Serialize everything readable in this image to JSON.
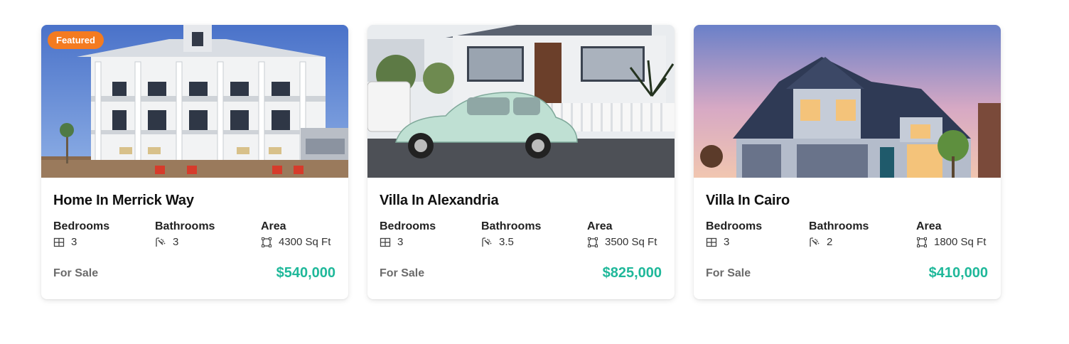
{
  "listings": [
    {
      "badge": "Featured",
      "title": "Home In Merrick Way",
      "bedrooms_label": "Bedrooms",
      "bedrooms": "3",
      "bathrooms_label": "Bathrooms",
      "bathrooms": "3",
      "area_label": "Area",
      "area": "4300 Sq Ft",
      "status": "For Sale",
      "price": "$540,000"
    },
    {
      "title": "Villa In Alexandria",
      "bedrooms_label": "Bedrooms",
      "bedrooms": "3",
      "bathrooms_label": "Bathrooms",
      "bathrooms": "3.5",
      "area_label": "Area",
      "area": "3500 Sq Ft",
      "status": "For Sale",
      "price": "$825,000"
    },
    {
      "title": "Villa In Cairo",
      "bedrooms_label": "Bedrooms",
      "bedrooms": "3",
      "bathrooms_label": "Bathrooms",
      "bathrooms": "2",
      "area_label": "Area",
      "area": "1800 Sq Ft",
      "status": "For Sale",
      "price": "$410,000"
    }
  ],
  "colors": {
    "badge": "#f47b20",
    "price": "#1fb89a"
  },
  "icons": [
    "bed-grid-icon",
    "shower-icon",
    "area-square-icon"
  ]
}
